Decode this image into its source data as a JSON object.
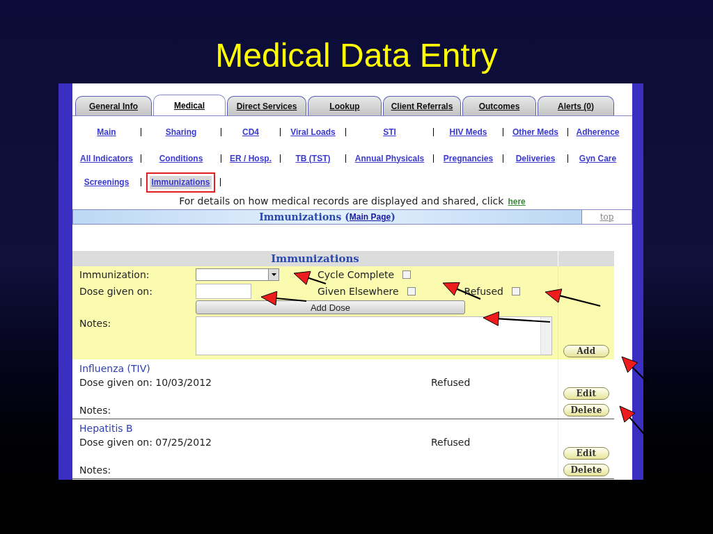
{
  "slide_title": "Medical Data Entry",
  "tabs": [
    {
      "label": "General Info",
      "selected": false
    },
    {
      "label": "Medical",
      "selected": true
    },
    {
      "label": "Direct Services",
      "selected": false
    },
    {
      "label": "Lookup",
      "selected": false
    },
    {
      "label": "Client Referrals",
      "selected": false
    },
    {
      "label": "Outcomes",
      "selected": false
    },
    {
      "label": "Alerts (0)",
      "selected": false
    }
  ],
  "subnav": [
    [
      {
        "label": "Main",
        "selected": false
      },
      {
        "label": "Sharing",
        "selected": false
      },
      {
        "label": "CD4",
        "selected": false
      },
      {
        "label": "Viral Loads",
        "selected": false
      },
      {
        "label": "STI",
        "selected": false
      },
      {
        "label": "HIV Meds",
        "selected": false
      },
      {
        "label": "Other Meds",
        "selected": false
      },
      {
        "label": "Adherence",
        "selected": false
      }
    ],
    [
      {
        "label": "All Indicators",
        "selected": false
      },
      {
        "label": "Conditions",
        "selected": false
      },
      {
        "label": "ER / Hosp.",
        "selected": false
      },
      {
        "label": "TB (TST)",
        "selected": false
      },
      {
        "label": "Annual Physicals",
        "selected": false
      },
      {
        "label": "Pregnancies",
        "selected": false
      },
      {
        "label": "Deliveries",
        "selected": false
      },
      {
        "label": "Gyn Care",
        "selected": false
      }
    ],
    [
      {
        "label": "Screenings",
        "selected": false
      },
      {
        "label": "Immunizations",
        "selected": true
      }
    ]
  ],
  "info": {
    "text": "For details on how medical records are displayed and shared, click",
    "link": "here"
  },
  "section_header": {
    "prefix": "Immunizations (",
    "link": "Main Page",
    "suffix": ")",
    "top_link": "top"
  },
  "form": {
    "heading": "Immunizations",
    "immunization_label": "Immunization:",
    "dose_label": "Dose given on:",
    "notes_label": "Notes:",
    "add_dose": "Add Dose",
    "add": "Add",
    "checks": [
      {
        "label": "Cycle Complete",
        "checked": false
      },
      {
        "label": "Given Elsewhere",
        "checked": false
      },
      {
        "label": "Refused",
        "checked": false
      }
    ]
  },
  "records": [
    {
      "name": "Influenza (TIV)",
      "dose": "Dose given on: 10/03/2012",
      "status": "Refused",
      "notes_label": "Notes:",
      "edit": "Edit",
      "delete": "Delete"
    },
    {
      "name": "Hepatitis B",
      "dose": "Dose given on: 07/25/2012",
      "status": "Refused",
      "notes_label": "Notes:",
      "edit": "Edit",
      "delete": "Delete"
    }
  ]
}
